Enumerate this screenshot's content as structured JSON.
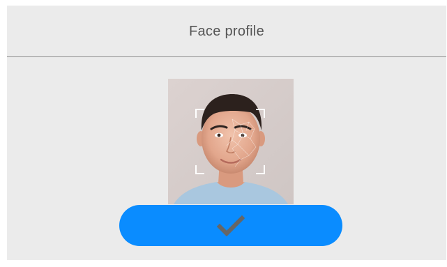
{
  "header": {
    "title": "Face profile"
  },
  "photo": {
    "subject": "face-portrait"
  },
  "confirm_button": {
    "icon": "checkmark-icon"
  },
  "colors": {
    "background": "#ebebeb",
    "accent": "#0a8cff",
    "divider": "#8e8e8e",
    "checkmark": "#666666",
    "title_text": "#555555"
  }
}
